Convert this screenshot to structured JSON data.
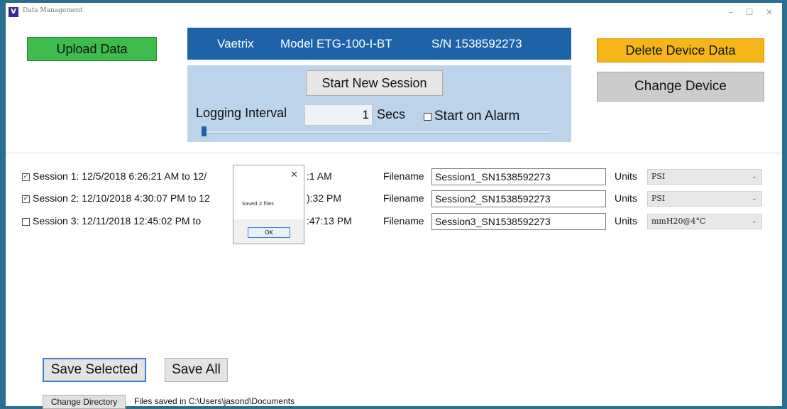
{
  "window": {
    "title": "Data Management",
    "app_icon": "V",
    "controls": {
      "minimize": "–",
      "maximize": "☐",
      "close": "✕"
    }
  },
  "header": {
    "brand": "Vaetrix",
    "model": "Model ETG-100-I-BT",
    "serial": "S/N 1538592273"
  },
  "buttons": {
    "upload": "Upload Data",
    "delete": "Delete Device Data",
    "change_device": "Change Device",
    "start_session": "Start New Session",
    "save_selected": "Save Selected",
    "save_all": "Save All",
    "change_directory": "Change Directory"
  },
  "logging": {
    "label": "Logging Interval",
    "value": "1",
    "unit": "Secs",
    "alarm_label": "Start on Alarm",
    "slider_level": 0
  },
  "colors": {
    "upload": "#3dbb4c",
    "delete": "#f6b618",
    "header": "#1e63a8",
    "panel": "#bcd3ea"
  },
  "sessions": [
    {
      "checked": true,
      "left": "Session 1: 12/5/2018 6:26:21 AM to 12/",
      "right": ":1 AM",
      "filename_label": "Filename",
      "filename": "Session1_SN1538592273",
      "units_label": "Units",
      "units": "PSI"
    },
    {
      "checked": true,
      "left": "Session 2: 12/10/2018 4:30:07 PM to 12",
      "right": "):32 PM",
      "filename_label": "Filename",
      "filename": "Session2_SN1538592273",
      "units_label": "Units",
      "units": "PSI"
    },
    {
      "checked": false,
      "left": "Session 3: 12/11/2018 12:45:02 PM to",
      "right": ":47:13 PM",
      "filename_label": "Filename",
      "filename": "Session3_SN1538592273",
      "units_label": "Units",
      "units": "mmH20@4°C"
    }
  ],
  "dialog": {
    "message": "Saved 2 files",
    "ok": "OK",
    "close": "✕"
  },
  "footer": {
    "saved_in": "Files saved in C:\\Users\\jasond\\Documents"
  }
}
